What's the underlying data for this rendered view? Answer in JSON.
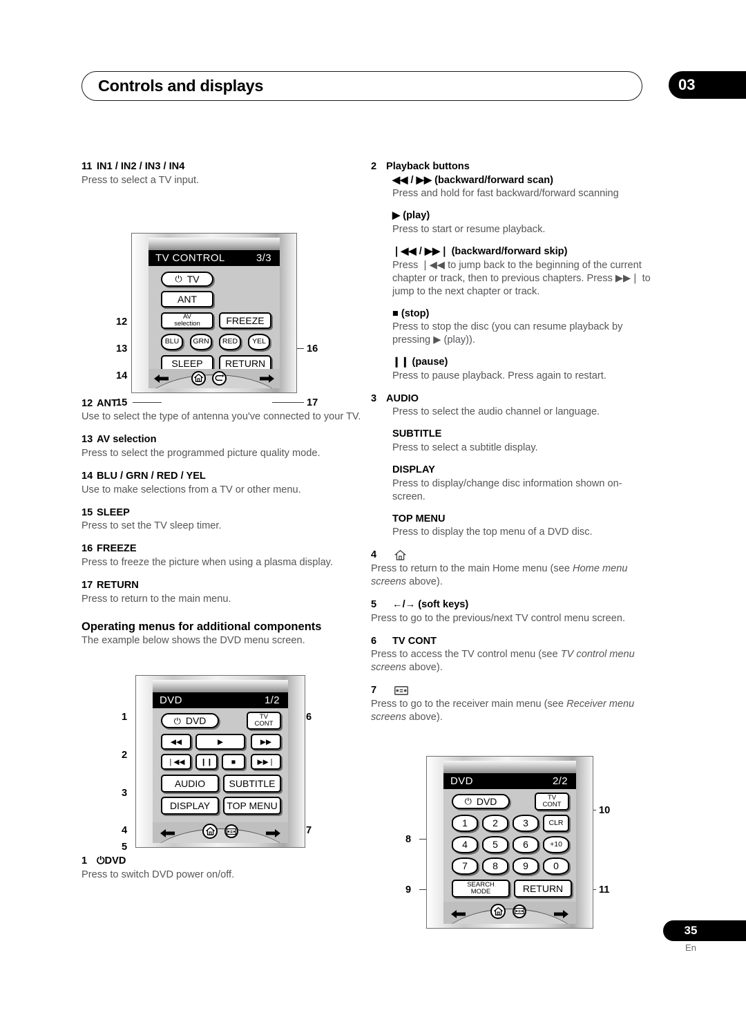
{
  "header": {
    "title": "Controls and displays",
    "chapter": "03"
  },
  "footer": {
    "page": "35",
    "lang": "En"
  },
  "left_column": {
    "item11": {
      "num": "11",
      "title": "IN1 / IN2 / IN3 / IN4",
      "body": "Press to select a TV input."
    },
    "item12": {
      "num": "12",
      "title": "ANT",
      "body": "Use to select the type of antenna you've connected to your TV."
    },
    "item13": {
      "num": "13",
      "title": "AV selection",
      "body": "Press to select the programmed picture quality mode."
    },
    "item14": {
      "num": "14",
      "title": "BLU / GRN / RED / YEL",
      "body": "Use to make selections from a TV or other menu."
    },
    "item15": {
      "num": "15",
      "title": "SLEEP",
      "body": "Press to set the TV sleep timer."
    },
    "item16": {
      "num": "16",
      "title": "FREEZE",
      "body": "Press to freeze the picture when using a plasma display."
    },
    "item17": {
      "num": "17",
      "title": "RETURN",
      "body": "Press to return to the main menu."
    },
    "section": {
      "title": "Operating menus for additional components",
      "subtitle": "The example below shows the DVD menu screen."
    },
    "item1": {
      "num": "1",
      "title": "DVD",
      "power_glyph": "⏻",
      "body": "Press to switch DVD power on/off."
    }
  },
  "right_column": {
    "item2": {
      "num": "2",
      "title": "Playback buttons",
      "subs": [
        {
          "title": "◀◀ / ▶▶ (backward/forward scan)",
          "body": "Press and hold for fast backward/forward scanning"
        },
        {
          "title": "▶ (play)",
          "body": "Press to start or resume playback."
        },
        {
          "title": "❘◀◀ / ▶▶❘ (backward/forward skip)",
          "body": "Press ❘◀◀ to jump back to the beginning of the current chapter or track, then to previous chapters. Press ▶▶❘ to jump to the next chapter or track."
        },
        {
          "title": "■ (stop)",
          "body": "Press to stop the disc (you can resume playback by pressing ▶ (play))."
        },
        {
          "title": "❙❙ (pause)",
          "body": "Press to pause playback. Press again to restart."
        }
      ]
    },
    "item3": {
      "num": "3",
      "title": "AUDIO",
      "body": "Press to select the audio channel or language.",
      "subs": [
        {
          "title": "SUBTITLE",
          "body": "Press to select a subtitle display."
        },
        {
          "title": "DISPLAY",
          "body": "Press to display/change disc information shown on-screen."
        },
        {
          "title": "TOP MENU",
          "body": "Press to display the top menu of a DVD disc."
        }
      ]
    },
    "item4": {
      "num": "4",
      "icon": "home-icon",
      "body_1": "Press to return to the main Home menu (see ",
      "body_italic": "Home menu screens",
      "body_2": " above)."
    },
    "item5": {
      "num": "5",
      "title": "←/→ (soft keys)",
      "body": "Press to go to the previous/next TV control menu screen."
    },
    "item6": {
      "num": "6",
      "title": "TV CONT",
      "body_1": "Press to access the TV control menu (see ",
      "body_italic": "TV control menu screens",
      "body_2": " above)."
    },
    "item7": {
      "num": "7",
      "icon": "receiver-icon",
      "body_1": "Press to go to the receiver main menu (see ",
      "body_italic": "Receiver menu screens",
      "body_2": " above)."
    }
  },
  "remote_tv_control": {
    "screen_label": "TV CONTROL",
    "screen_page": "3/3",
    "power_glyph": "⏻",
    "buttons": {
      "power_tv": "TV",
      "ant": "ANT",
      "av_line1": "AV",
      "av_line2": "selection",
      "freeze": "FREEZE",
      "blu": "BLU",
      "grn": "GRN",
      "red": "RED",
      "yel": "YEL",
      "sleep": "SLEEP",
      "return": "RETURN"
    },
    "foot_icons": [
      "home-icon",
      "return-icon"
    ],
    "callouts": [
      "12",
      "13",
      "14",
      "15",
      "16",
      "17"
    ]
  },
  "remote_dvd_1": {
    "screen_label": "DVD",
    "screen_page": "1/2",
    "power_glyph": "⏻",
    "buttons": {
      "power_dvd": "DVD",
      "tv_cont_line1": "TV",
      "tv_cont_line2": "CONT",
      "scan_back": "◀◀",
      "play": "▶",
      "scan_fwd": "▶▶",
      "skip_back": "❘◀◀",
      "pause": "❙❙",
      "stop": "■",
      "skip_fwd": "▶▶❘",
      "audio": "AUDIO",
      "subtitle": "SUBTITLE",
      "display": "DISPLAY",
      "top_menu": "TOP MENU"
    },
    "foot_icons": [
      "home-icon",
      "receiver-icon"
    ],
    "callouts": [
      "1",
      "2",
      "3",
      "4",
      "5",
      "6",
      "7"
    ]
  },
  "remote_dvd_2": {
    "screen_label": "DVD",
    "screen_page": "2/2",
    "power_glyph": "⏻",
    "buttons": {
      "power_dvd": "DVD",
      "tv_cont_line1": "TV",
      "tv_cont_line2": "CONT",
      "k1": "1",
      "k2": "2",
      "k3": "3",
      "clr": "CLR",
      "k4": "4",
      "k5": "5",
      "k6": "6",
      "plus10": "+10",
      "k7": "7",
      "k8": "8",
      "k9": "9",
      "k0": "0",
      "search_line1": "SEARCH",
      "search_line2": "MODE",
      "return": "RETURN"
    },
    "foot_icons": [
      "home-icon",
      "receiver-icon"
    ],
    "callouts": [
      "8",
      "9",
      "10",
      "11"
    ]
  }
}
